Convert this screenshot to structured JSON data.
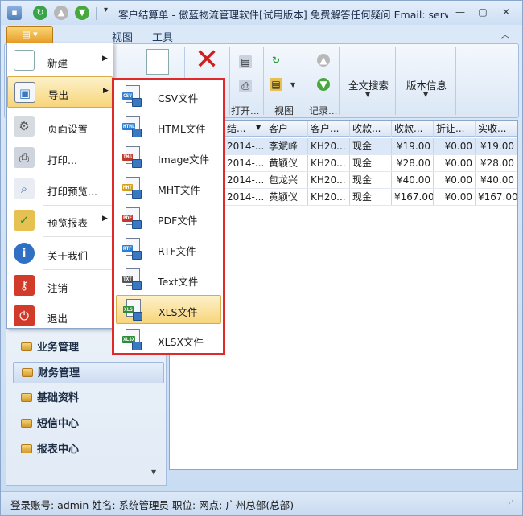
{
  "window": {
    "title": "客户结算单 - 傲蓝物流管理软件[试用版本] 免费解答任何疑问 Email: serv..."
  },
  "tabs": {
    "view": "视图",
    "tools": "工具"
  },
  "ribbon": {
    "group_open_label": "打开...",
    "group_view_label": "视图",
    "group_records_label": "记录...",
    "fulltext_search": "全文搜索",
    "version_info": "版本信息"
  },
  "grid": {
    "columns": [
      "结...",
      "客户",
      "客户...",
      "收款...",
      "收款...",
      "折让...",
      "实收..."
    ],
    "rows": [
      [
        "2014-...",
        "李斌峰",
        "KH20...",
        "现金",
        "¥19.00",
        "¥0.00",
        "¥19.00"
      ],
      [
        "2014-...",
        "黄颖仪",
        "KH20...",
        "现金",
        "¥28.00",
        "¥0.00",
        "¥28.00"
      ],
      [
        "2014-...",
        "包龙兴",
        "KH20...",
        "现金",
        "¥40.00",
        "¥0.00",
        "¥40.00"
      ],
      [
        "2014-...",
        "黄颖仪",
        "KH20...",
        "现金",
        "¥167.00",
        "¥0.00",
        "¥167.00"
      ]
    ]
  },
  "nav": {
    "items": [
      "业务管理",
      "财务管理",
      "基础资料",
      "短信中心",
      "报表中心"
    ]
  },
  "app_menu": {
    "items": [
      "新建",
      "导出",
      "页面设置",
      "打印...",
      "打印预览...",
      "预览报表",
      "关于我们",
      "注销",
      "退出"
    ]
  },
  "export_menu": {
    "items": [
      {
        "label": "CSV文件",
        "tag": "CSV",
        "color": "#2f7fd0"
      },
      {
        "label": "HTML文件",
        "tag": "HTML",
        "color": "#2f7fd0"
      },
      {
        "label": "Image文件",
        "tag": "IMG",
        "color": "#c0392b"
      },
      {
        "label": "MHT文件",
        "tag": "MHT",
        "color": "#d4a017"
      },
      {
        "label": "PDF文件",
        "tag": "PDF",
        "color": "#c0392b"
      },
      {
        "label": "RTF文件",
        "tag": "RTF",
        "color": "#2f7fd0"
      },
      {
        "label": "Text文件",
        "tag": "TXT",
        "color": "#555555"
      },
      {
        "label": "XLS文件",
        "tag": "XLS",
        "color": "#2e8b3a"
      },
      {
        "label": "XLSX文件",
        "tag": "XLSX",
        "color": "#2e8b3a"
      }
    ]
  },
  "status": {
    "text": "登录账号: admin  姓名: 系统管理员  职位:    网点: 广州总部(总部)"
  },
  "colors": {
    "highlight": "#f7d57b",
    "annotation_border": "#e02a2a",
    "accent": "#e99d2a"
  }
}
